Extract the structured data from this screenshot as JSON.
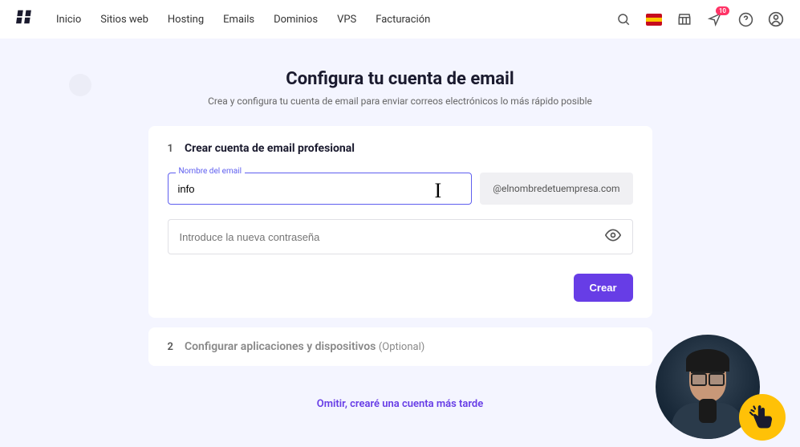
{
  "nav": {
    "items": [
      "Inicio",
      "Sitios web",
      "Hosting",
      "Emails",
      "Dominios",
      "VPS",
      "Facturación"
    ]
  },
  "topbar": {
    "notification_badge": "10"
  },
  "page": {
    "title": "Configura tu cuenta de email",
    "subtitle": "Crea y configura tu cuenta de email para enviar correos electrónicos lo más rápido posible"
  },
  "step1": {
    "num": "1",
    "title": "Crear cuenta de email profesional",
    "email_label": "Nombre del email",
    "email_value": "info",
    "domain": "@elnombredetuempresa.com",
    "password_placeholder": "Introduce la nueva contraseña",
    "create_button": "Crear"
  },
  "step2": {
    "num": "2",
    "title": "Configurar aplicaciones y dispositivos",
    "optional": "(Optional)"
  },
  "skip": {
    "label": "Omitir, crearé una cuenta más tarde"
  }
}
